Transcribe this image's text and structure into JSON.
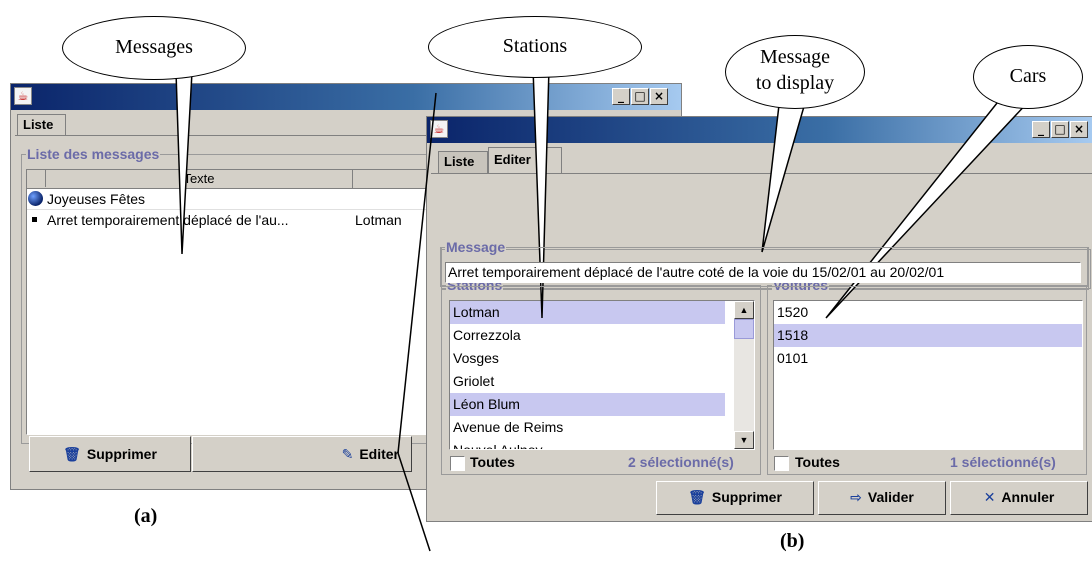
{
  "window_a": {
    "tab_liste": "Liste",
    "group_label": "Liste des messages",
    "column_texte": "Texte",
    "rows": [
      {
        "text": "Joyeuses Fêtes",
        "station": "",
        "icon": "globe-icon"
      },
      {
        "text": "Arret temporairement déplacé de l'au...",
        "station": "Lotman",
        "icon": "bullet-icon"
      }
    ],
    "btn_supprimer": "Supprimer",
    "btn_editer": "Editer"
  },
  "window_b": {
    "tab_liste": "Liste",
    "tab_editer": "Editer",
    "message_label": "Message",
    "message_value": "Arret temporairement déplacé de l'autre coté de la voie du 15/02/01 au 20/02/01",
    "stations_label": "Stations",
    "stations": [
      {
        "name": "Lotman",
        "selected": true
      },
      {
        "name": "Correzzola",
        "selected": false
      },
      {
        "name": "Vosges",
        "selected": false
      },
      {
        "name": "Griolet",
        "selected": false
      },
      {
        "name": "Léon Blum",
        "selected": true
      },
      {
        "name": "Avenue de Reims",
        "selected": false
      },
      {
        "name": "Nouvel Aulnov",
        "selected": false
      }
    ],
    "stations_toutes": "Toutes",
    "stations_count": "2 sélectionné(s)",
    "voitures_label": "Voitures",
    "voitures": [
      {
        "name": "1520",
        "selected": false
      },
      {
        "name": "1518",
        "selected": true
      },
      {
        "name": "0101",
        "selected": false
      }
    ],
    "voitures_toutes": "Toutes",
    "voitures_count": "1 sélectionné(s)",
    "btn_supprimer": "Supprimer",
    "btn_valider": "Valider",
    "btn_annuler": "Annuler"
  },
  "callouts": {
    "messages": "Messages",
    "stations": "Stations",
    "message_line1": "Message",
    "message_line2": "to display",
    "cars": "Cars"
  },
  "captions": {
    "a": "(a)",
    "b": "(b)"
  }
}
